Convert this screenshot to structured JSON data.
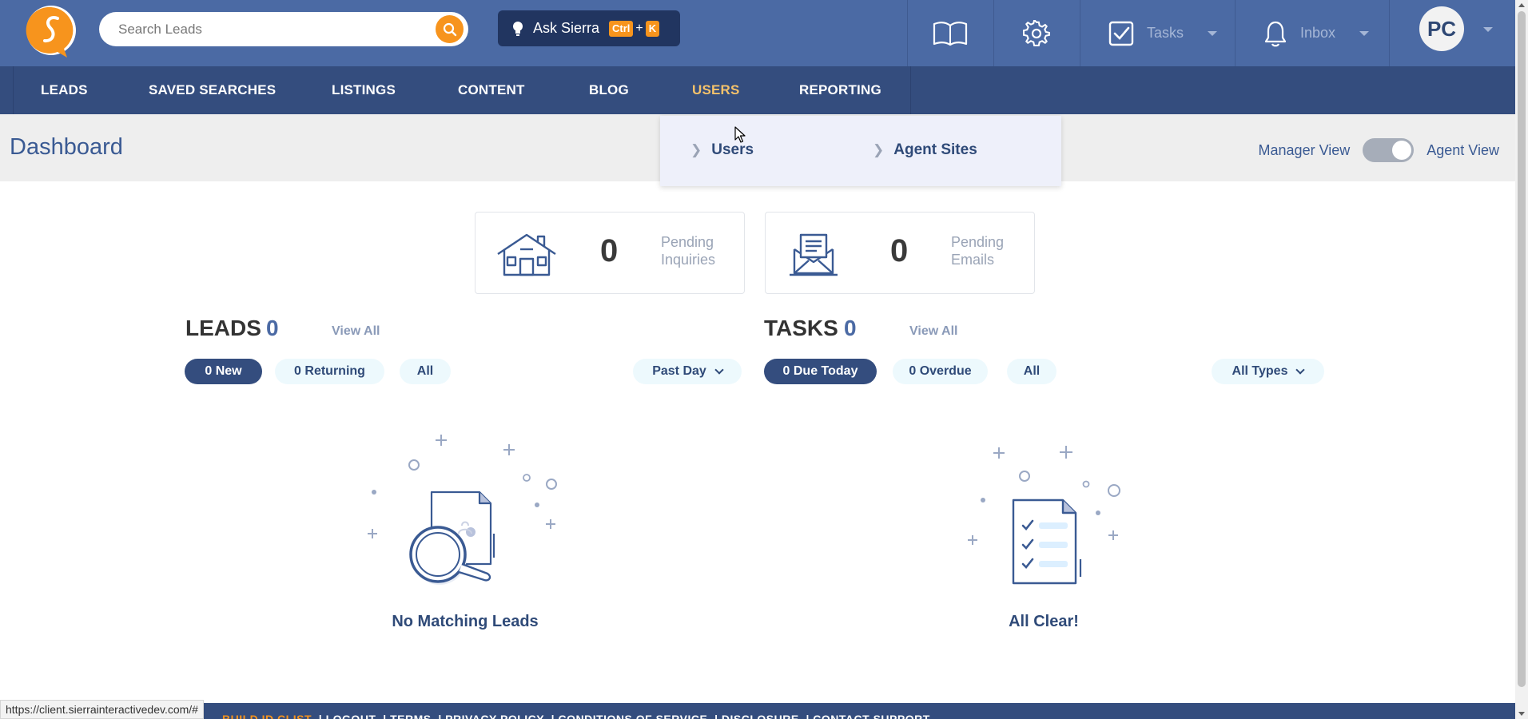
{
  "header": {
    "search": {
      "placeholder": "Search Leads",
      "value": ""
    },
    "ask": {
      "label": "Ask Sierra",
      "key1": "Ctrl",
      "plus": "+",
      "key2": "K"
    },
    "tasks_label": "Tasks",
    "inbox_label": "Inbox",
    "avatar_initials": "PC",
    "accent_color": "#f7941d",
    "bar_color": "#4b6aa4"
  },
  "nav": {
    "items": [
      {
        "label": "LEADS"
      },
      {
        "label": "SAVED SEARCHES"
      },
      {
        "label": "LISTINGS"
      },
      {
        "label": "CONTENT"
      },
      {
        "label": "BLOG"
      },
      {
        "label": "USERS",
        "active": true
      },
      {
        "label": "REPORTING"
      }
    ],
    "dropdown": [
      {
        "label": "Users"
      },
      {
        "label": "Agent Sites"
      }
    ]
  },
  "page": {
    "title": "Dashboard",
    "view_toggle": {
      "left_label": "Manager View",
      "right_label": "Agent View",
      "selected": "Agent View"
    }
  },
  "stats": [
    {
      "value": "0",
      "label_line1": "Pending",
      "label_line2": "Inquiries",
      "icon": "house-icon"
    },
    {
      "value": "0",
      "label_line1": "Pending",
      "label_line2": "Emails",
      "icon": "envelope-icon"
    }
  ],
  "leads": {
    "title": "LEADS",
    "count": "0",
    "view_all": "View All",
    "filters": [
      "0 New",
      "0 Returning",
      "All"
    ],
    "period": "Past Day",
    "empty_text": "No Matching Leads"
  },
  "tasks": {
    "title": "TASKS",
    "count": "0",
    "view_all": "View All",
    "filters": [
      "0 Due Today",
      "0 Overdue",
      "All"
    ],
    "type": "All Types",
    "empty_text": "All Clear!"
  },
  "footer": {
    "brand": "BUILD ID CLIST",
    "links": [
      "LOGOUT",
      "TERMS",
      "PRIVACY POLICY",
      "CONDITIONS OF SERVICE",
      "DISCLOSURE",
      "CONTACT SUPPORT"
    ]
  },
  "status_url": "https://client.sierrainteractivedev.com/#"
}
